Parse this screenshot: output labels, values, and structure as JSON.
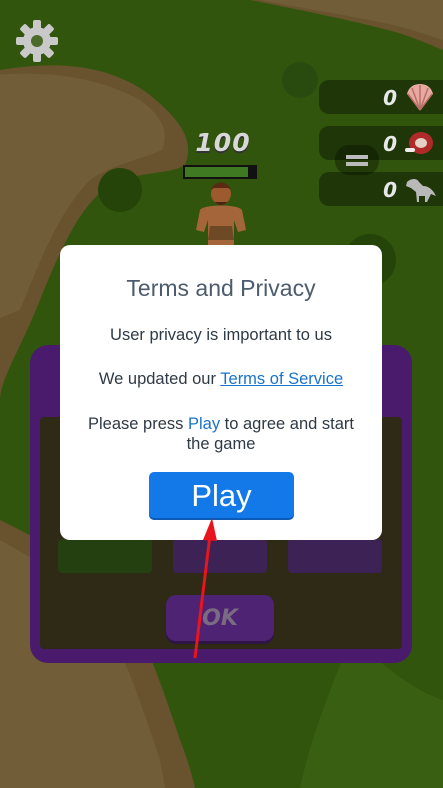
{
  "hud": {
    "resources": [
      {
        "value": "0",
        "icon": "shell-icon"
      },
      {
        "value": "0",
        "icon": "meat-icon"
      },
      {
        "value": "0",
        "icon": "dinosaur-icon"
      }
    ],
    "hero_hp": "100",
    "hero_hp_fraction": 0.9
  },
  "panel": {
    "ok_label": "OK"
  },
  "dialog": {
    "title": "Terms and Privacy",
    "line1": "User privacy is important to us",
    "line2_prefix": "We updated our ",
    "line2_link": "Terms of Service",
    "line3_prefix": "Please press ",
    "line3_link": "Play",
    "line3_suffix": " to agree and start",
    "line3b": "the game",
    "play_label": "Play"
  },
  "colors": {
    "accent": "#1479e8",
    "link": "#1a73c9",
    "arrow": "#e8141e"
  }
}
